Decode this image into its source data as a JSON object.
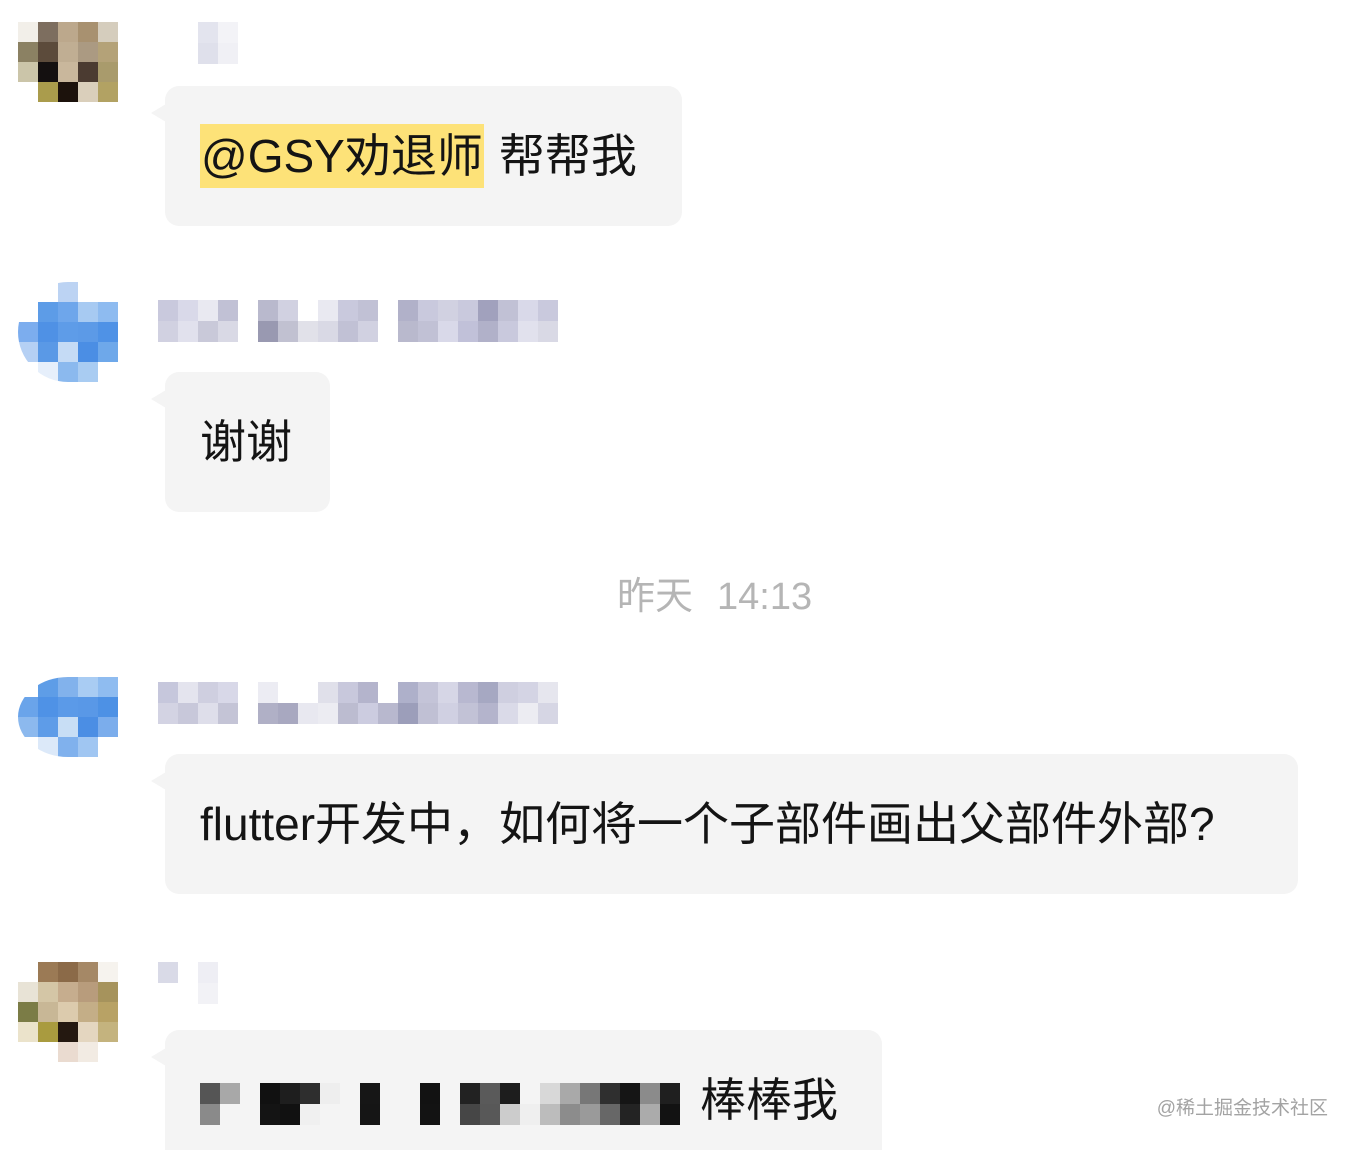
{
  "theme": {
    "bubble_background": "#f4f4f4",
    "text": "#141414",
    "mention_highlight": "#fde278",
    "timestamp": "#b5b5b5",
    "watermark": "#a3a3a3"
  },
  "messages": [
    {
      "avatar_mosaic": [
        [
          "#f2efe9",
          "#7d6e5f",
          "#bca88c",
          "#a89170",
          "#d5cdbd"
        ],
        [
          "#8b8163",
          "#5c4b3b",
          "#c0ae93",
          "#ab9a82",
          "#b4a278"
        ],
        [
          "#cbc5a9",
          "#141010",
          "#c9b79c",
          "#4b3b31",
          "#a99b6c"
        ],
        [
          "#ffffff",
          "#aa9c4c",
          "#1c120c",
          "#dacfbb",
          "#b2a263"
        ]
      ],
      "sender_mosaic": [
        [
          "#e3e4ee",
          "#f3f3f7"
        ],
        [
          "#dfe0eb",
          "#f0f0f5"
        ]
      ],
      "mention": "@GSY劝退师",
      "text": "帮帮我"
    },
    {
      "avatar_mosaic": [
        [
          "#ffffff",
          "#ffffff",
          "#bcd3f3",
          "#ffffff",
          "#ffffff"
        ],
        [
          "#ffffff",
          "#5d9ce7",
          "#6ea6eb",
          "#a7caf2",
          "#8ebbf0"
        ],
        [
          "#7cadee",
          "#4f91e5",
          "#5e9ce8",
          "#5c9ae7",
          "#4f92e6"
        ],
        [
          "#b5d0f4",
          "#5a99e6",
          "#c5dbf5",
          "#4b8ee4",
          "#6ea8ea"
        ],
        [
          "#ffffff",
          "#e6effb",
          "#8bb9ee",
          "#a9ccf2",
          "#ffffff"
        ]
      ],
      "sender_mosaic": [
        [
          "#c9c9dd",
          "#d9d9e9",
          "#e9e9f1",
          "#c1c1d5",
          "#ffffff",
          "#b9b9cd",
          "#d1d1e1",
          "#ffffff",
          "#e9e9f1",
          "#c9c9dd",
          "#c1c1d5",
          "#ffffff",
          "#b1b1c9",
          "#c9c9dd",
          "#d1d1e1",
          "#c9c9dd",
          "#a1a1bd",
          "#c1c1d5",
          "#d9d9e9",
          "#c9c9dd"
        ],
        [
          "#d1d1e1",
          "#e1e1ed",
          "#c9c9d9",
          "#d9d9e5",
          "#ffffff",
          "#9999b1",
          "#c1c1d1",
          "#e1e1e9",
          "#d9d9e5",
          "#c1c1d5",
          "#d1d1e1",
          "#ffffff",
          "#b9b9cd",
          "#c1c1d5",
          "#d9d9e9",
          "#c1c1d9",
          "#b1b1c9",
          "#c9c9dd",
          "#e1e1ed",
          "#d9d9e5"
        ]
      ],
      "text": "谢谢"
    },
    {
      "avatar_mosaic": [
        [
          "#ffffff",
          "#5e9de7",
          "#82b2ec",
          "#a9ccf3",
          "#8fbcf0"
        ],
        [
          "#6aa4ea",
          "#4f92e6",
          "#5b9ae8",
          "#5998e7",
          "#4d91e5"
        ],
        [
          "#8cb9ee",
          "#5e9ce8",
          "#c8def5",
          "#4b8ee4",
          "#7badec"
        ],
        [
          "#ffffff",
          "#dce9f9",
          "#80b1ed",
          "#a0c6f2",
          "#ffffff"
        ]
      ],
      "sender_mosaic": [
        [
          "#c6c7dc",
          "#e4e4ee",
          "#cfcfe0",
          "#d8d8e8",
          "#ffffff",
          "#ececf3",
          "#ffffff",
          "#ffffff",
          "#e0e0ea",
          "#c8c8dc",
          "#b4b4cc",
          "#ffffff",
          "#aeb0ca",
          "#c4c4d8",
          "#d6d6e6",
          "#b8b8d0",
          "#a6a8c2",
          "#cfcfe0",
          "#d4d4e4",
          "#e6e6ee"
        ],
        [
          "#d3d3e3",
          "#c8c8da",
          "#dedeea",
          "#c4c4d6",
          "#ffffff",
          "#b0b0c6",
          "#a8a8c0",
          "#e8e8f0",
          "#ececf2",
          "#bcbcd0",
          "#cccce0",
          "#b8b8ce",
          "#9c9eba",
          "#c0c0d4",
          "#d0d0e2",
          "#c2c2d6",
          "#b4b4cc",
          "#dadae8",
          "#ececf2",
          "#d6d6e4"
        ]
      ],
      "text": "flutter开发中，如何将一个子部件画出父部件外部?"
    },
    {
      "avatar_mosaic": [
        [
          "#ffffff",
          "#9b7a55",
          "#8b6a48",
          "#a58866",
          "#f6f3ee"
        ],
        [
          "#e8e3d6",
          "#d4c6a6",
          "#c6ad8e",
          "#b89c7c",
          "#a6935c"
        ],
        [
          "#7b7c46",
          "#c8b796",
          "#dccbad",
          "#c4ae87",
          "#b8a265"
        ],
        [
          "#ebe3cb",
          "#a99b3f",
          "#241810",
          "#e4d6c0",
          "#c4b37e"
        ],
        [
          "#ffffff",
          "#ffffff",
          "#eadbd0",
          "#f2ebe3",
          "#ffffff"
        ]
      ],
      "sender_mosaic": [
        [
          "#d9dae7",
          "#ffffff",
          "#eeeef4",
          "#ffffff"
        ],
        [
          "#ffffff",
          "#ffffff",
          "#f2f2f6",
          "#ffffff"
        ]
      ],
      "mention_mosaic": [
        [
          "#555555",
          "#a8a8a8",
          "#f4f4f4",
          "#111111",
          "#1e1e1e",
          "#2e2e2e",
          "#eeeeee",
          "#f4f4f4",
          "#161616",
          "#f4f4f4",
          "#f4f4f4",
          "#121212",
          "#f4f4f4",
          "#222222",
          "#5a5a5a",
          "#1d1d1d",
          "#f4f4f4",
          "#d8d8d8",
          "#a9a9a9",
          "#777777",
          "#2f2f2f",
          "#151515",
          "#8b8b8b",
          "#1f1f1f"
        ],
        [
          "#8a8a8a",
          "#f4f4f4",
          "#f4f4f4",
          "#141414",
          "#111111",
          "#f0f0f0",
          "#f4f4f4",
          "#f4f4f4",
          "#151515",
          "#f4f4f4",
          "#f4f4f4",
          "#131313",
          "#f4f4f4",
          "#464646",
          "#585858",
          "#cccccc",
          "#efefef",
          "#bcbcbc",
          "#8c8c8c",
          "#9a9a9a",
          "#676767",
          "#232323",
          "#ababab",
          "#121212"
        ]
      ],
      "text": "棒棒我"
    }
  ],
  "timestamp": {
    "day": "昨天",
    "time": "14:13"
  },
  "watermark": "@稀土掘金技术社区"
}
